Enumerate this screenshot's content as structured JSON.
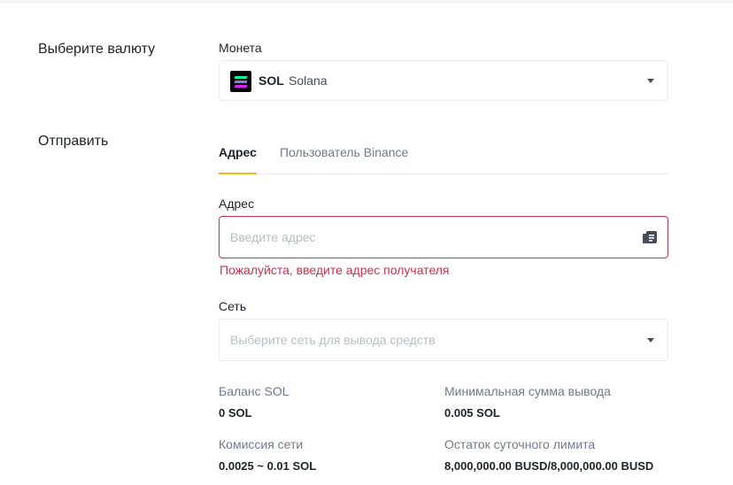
{
  "currency_section": {
    "title": "Выберите валюту",
    "coin_label": "Монета",
    "selected_coin": {
      "symbol": "SOL",
      "name": "Solana",
      "icon": "solana-logo-icon"
    }
  },
  "send_section": {
    "title": "Отправить",
    "tabs": [
      {
        "label": "Адрес",
        "active": true
      },
      {
        "label": "Пользователь Binance",
        "active": false
      }
    ],
    "address": {
      "label": "Адрес",
      "placeholder": "Введите адрес",
      "error": "Пожалуйста, введите адрес получателя",
      "icon": "address-book-icon"
    },
    "network": {
      "label": "Сеть",
      "placeholder": "Выберите сеть для вывода средств"
    }
  },
  "info": {
    "balance_label": "Баланс SOL",
    "balance_value": "0 SOL",
    "min_withdraw_label": "Минимальная сумма вывода",
    "min_withdraw_value": "0.005 SOL",
    "fee_label": "Комиссия сети",
    "fee_value": "0.0025 ~ 0.01 SOL",
    "daily_limit_label": "Остаток суточного лимита",
    "daily_limit_value": "8,000,000.00 BUSD/8,000,000.00 BUSD"
  },
  "colors": {
    "accent": "#f0b90b",
    "error": "#cf304a",
    "text_primary": "#1e2329",
    "text_secondary": "#707a8a",
    "placeholder": "#b7bdc6",
    "border": "#eaecef"
  }
}
